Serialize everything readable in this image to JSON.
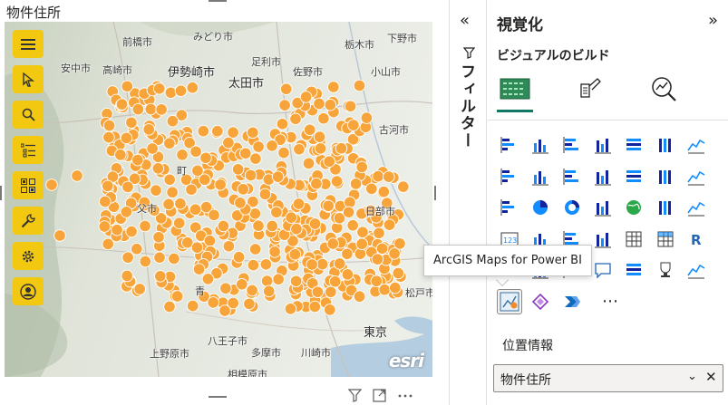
{
  "visual": {
    "title": "物件住所",
    "map_labels": [
      {
        "text": "前橋市",
        "big": false
      },
      {
        "text": "みどり市",
        "big": false
      },
      {
        "text": "栃木市",
        "big": false
      },
      {
        "text": "下野市",
        "big": false
      },
      {
        "text": "安中市",
        "big": false
      },
      {
        "text": "高崎市",
        "big": false
      },
      {
        "text": "伊勢崎市",
        "big": true
      },
      {
        "text": "足利市",
        "big": false
      },
      {
        "text": "佐野市",
        "big": false
      },
      {
        "text": "小山市",
        "big": false
      },
      {
        "text": "太田市",
        "big": true
      },
      {
        "text": "古河市",
        "big": false
      },
      {
        "text": "町",
        "big": false
      },
      {
        "text": "父市",
        "big": false
      },
      {
        "text": "日部市",
        "big": false
      },
      {
        "text": "青",
        "big": false
      },
      {
        "text": "松戸市",
        "big": false
      },
      {
        "text": "東京",
        "big": true
      },
      {
        "text": "八王子市",
        "big": false
      },
      {
        "text": "多摩市",
        "big": false
      },
      {
        "text": "川崎市",
        "big": false
      },
      {
        "text": "上野原市",
        "big": false
      },
      {
        "text": "相模原市",
        "big": false
      }
    ],
    "attribution": "esri",
    "tools": [
      {
        "name": "menu-icon"
      },
      {
        "name": "select-pointer-icon"
      },
      {
        "name": "search-icon"
      },
      {
        "name": "layers-list-icon"
      },
      {
        "name": "basemap-gallery-icon"
      },
      {
        "name": "analysis-wrench-icon"
      },
      {
        "name": "settings-gear-icon"
      },
      {
        "name": "profile-icon"
      }
    ],
    "footer_icons": [
      "filter-icon",
      "focus-mode-icon",
      "more-options-icon"
    ],
    "point_color": "#f7a53a",
    "tool_color": "#f2c811"
  },
  "filter_pane": {
    "collapse_label": "«",
    "label": "フィルター"
  },
  "viz_pane": {
    "title": "視覚化",
    "expand_label": "»",
    "build_label": "ビジュアルのビルド",
    "build_tabs": [
      "build-visual-icon",
      "format-visual-icon",
      "analytics-icon"
    ],
    "selected_visual": "ArcGIS Maps for Power BI",
    "more_label": "⋯",
    "tooltip": "ArcGIS Maps for Power BI",
    "field_well_label": "位置情報",
    "field_well_value": "物件住所",
    "accent_color": "#117865"
  }
}
